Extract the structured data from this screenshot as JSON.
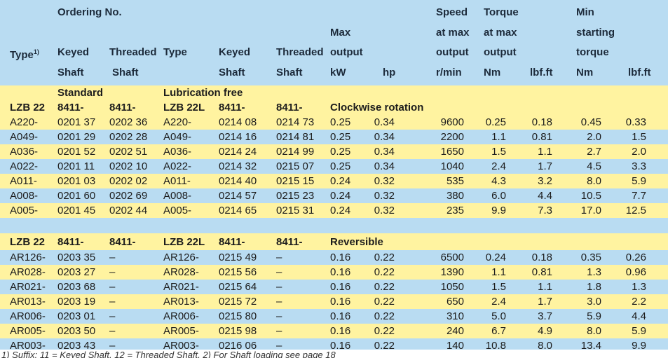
{
  "header": {
    "ordering_no": "Ordering No.",
    "max": "Max",
    "output": "output",
    "speed": "Speed",
    "at_max_speed": "at max",
    "output_speed": "output",
    "torque": "Torque",
    "at_max_torque": "at max",
    "output_torque": "output",
    "min": "Min",
    "starting": "starting",
    "torque2": "torque",
    "type": "Type",
    "type_sup": "1)",
    "keyed": "Keyed",
    "threaded": "Threaded",
    "type2": "Type",
    "keyed2": "Keyed",
    "threaded2": "Threaded",
    "shaft1": "Shaft",
    "shaft2": "Shaft",
    "shaft3": "Shaft",
    "shaft4": "Shaft",
    "kw": "kW",
    "hp": "hp",
    "rmin": "r/min",
    "nm1": "Nm",
    "lbfft1": "lbf.ft",
    "nm2": "Nm",
    "lbfft2": "lbf.ft"
  },
  "section1": {
    "standard": "Standard",
    "lubrication_free": "Lubrication free",
    "model": "LZB 22",
    "prefix1": "8411-",
    "prefix2": "8411-",
    "model2": "LZB 22L",
    "prefix3": "8411-",
    "prefix4": "8411-",
    "rotation": "Clockwise rotation",
    "rows": [
      [
        "A220-",
        "0201 37",
        "0202 36",
        "A220-",
        "0214 08",
        "0214 73",
        "0.25",
        "0.34",
        "9600",
        "0.25",
        "0.18",
        "0.45",
        "0.33"
      ],
      [
        "A049-",
        "0201 29",
        "0202 28",
        "A049-",
        "0214 16",
        "0214 81",
        "0.25",
        "0.34",
        "2200",
        "1.1",
        "0.81",
        "2.0",
        "1.5"
      ],
      [
        "A036-",
        "0201 52",
        "0202 51",
        "A036-",
        "0214 24",
        "0214 99",
        "0.25",
        "0.34",
        "1650",
        "1.5",
        "1.1",
        "2.7",
        "2.0"
      ],
      [
        "A022-",
        "0201 11",
        "0202 10",
        "A022-",
        "0214 32",
        "0215 07",
        "0.25",
        "0.34",
        "1040",
        "2.4",
        "1.7",
        "4.5",
        "3.3"
      ],
      [
        "A011-",
        "0201 03",
        "0202 02",
        "A011-",
        "0214 40",
        "0215 15",
        "0.24",
        "0.32",
        "535",
        "4.3",
        "3.2",
        "8.0",
        "5.9"
      ],
      [
        "A008-",
        "0201 60",
        "0202 69",
        "A008-",
        "0214 57",
        "0215 23",
        "0.24",
        "0.32",
        "380",
        "6.0",
        "4.4",
        "10.5",
        "7.7"
      ],
      [
        "A005-",
        "0201 45",
        "0202 44",
        "A005-",
        "0214 65",
        "0215 31",
        "0.24",
        "0.32",
        "235",
        "9.9",
        "7.3",
        "17.0",
        "12.5"
      ]
    ]
  },
  "section2": {
    "model": "LZB 22",
    "prefix1": "8411-",
    "prefix2": "8411-",
    "model2": "LZB 22L",
    "prefix3": "8411-",
    "prefix4": "8411-",
    "rotation": "Reversible",
    "rows": [
      [
        "AR126-",
        "0203 35",
        "–",
        "AR126-",
        "0215 49",
        "–",
        "0.16",
        "0.22",
        "6500",
        "0.24",
        "0.18",
        "0.35",
        "0.26"
      ],
      [
        "AR028-",
        "0203 27",
        "–",
        "AR028-",
        "0215 56",
        "–",
        "0.16",
        "0.22",
        "1390",
        "1.1",
        "0.81",
        "1.3",
        "0.96"
      ],
      [
        "AR021-",
        "0203 68",
        "–",
        "AR021-",
        "0215 64",
        "–",
        "0.16",
        "0.22",
        "1050",
        "1.5",
        "1.1",
        "1.8",
        "1.3"
      ],
      [
        "AR013-",
        "0203 19",
        "–",
        "AR013-",
        "0215 72",
        "–",
        "0.16",
        "0.22",
        "650",
        "2.4",
        "1.7",
        "3.0",
        "2.2"
      ],
      [
        "AR006-",
        "0203 01",
        "–",
        "AR006-",
        "0215 80",
        "–",
        "0.16",
        "0.22",
        "310",
        "5.0",
        "3.7",
        "5.9",
        "4.4"
      ],
      [
        "AR005-",
        "0203 50",
        "–",
        "AR005-",
        "0215 98",
        "–",
        "0.16",
        "0.22",
        "240",
        "6.7",
        "4.9",
        "8.0",
        "5.9"
      ],
      [
        "AR003-",
        "0203 43",
        "–",
        "AR003-",
        "0216 06",
        "–",
        "0.16",
        "0.22",
        "140",
        "10.8",
        "8.0",
        "13.4",
        "9.9"
      ]
    ]
  },
  "footnote": "1) Suffix: 11 = Keyed Shaft, 12 = Threaded Shaft, 2) For Shaft loading see page 18"
}
